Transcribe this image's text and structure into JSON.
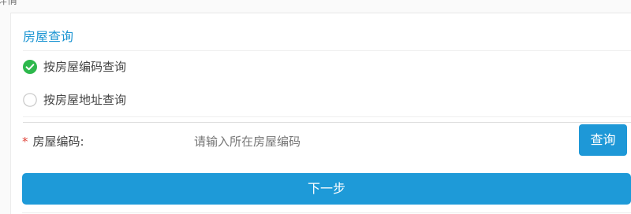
{
  "top_strip": {
    "label": "详情"
  },
  "section": {
    "title": "房屋查询"
  },
  "options": [
    {
      "label": "按房屋编码查询",
      "selected": true,
      "icon": "check-circle-icon"
    },
    {
      "label": "按房屋地址查询",
      "selected": false,
      "icon": "radio-empty-icon"
    }
  ],
  "form": {
    "required_mark": "*",
    "label": "房屋编码:",
    "value": "",
    "placeholder": "请输入所在房屋编码",
    "query_label": "查询"
  },
  "actions": {
    "next_label": "下一步"
  },
  "colors": {
    "accent": "#1e98d7",
    "title": "#1a94d2",
    "selected": "#2db84c",
    "required": "#e0443a"
  }
}
